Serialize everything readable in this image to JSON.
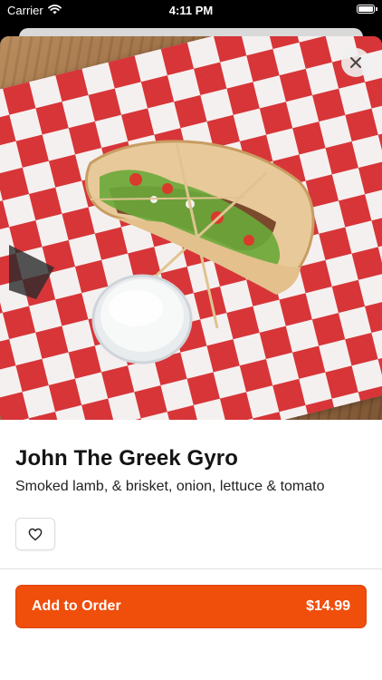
{
  "status_bar": {
    "carrier": "Carrier",
    "time": "4:11 PM",
    "wifi_icon": "wifi-icon",
    "battery_icon": "battery-icon"
  },
  "item": {
    "title": "John The Greek Gyro",
    "description": "Smoked lamb, & brisket, onion, lettuce & tomato",
    "favorite_icon": "heart-outline-icon",
    "close_icon": "close-icon"
  },
  "order": {
    "add_label": "Add to Order",
    "price": "$14.99",
    "accent_color": "#f04e0b"
  }
}
